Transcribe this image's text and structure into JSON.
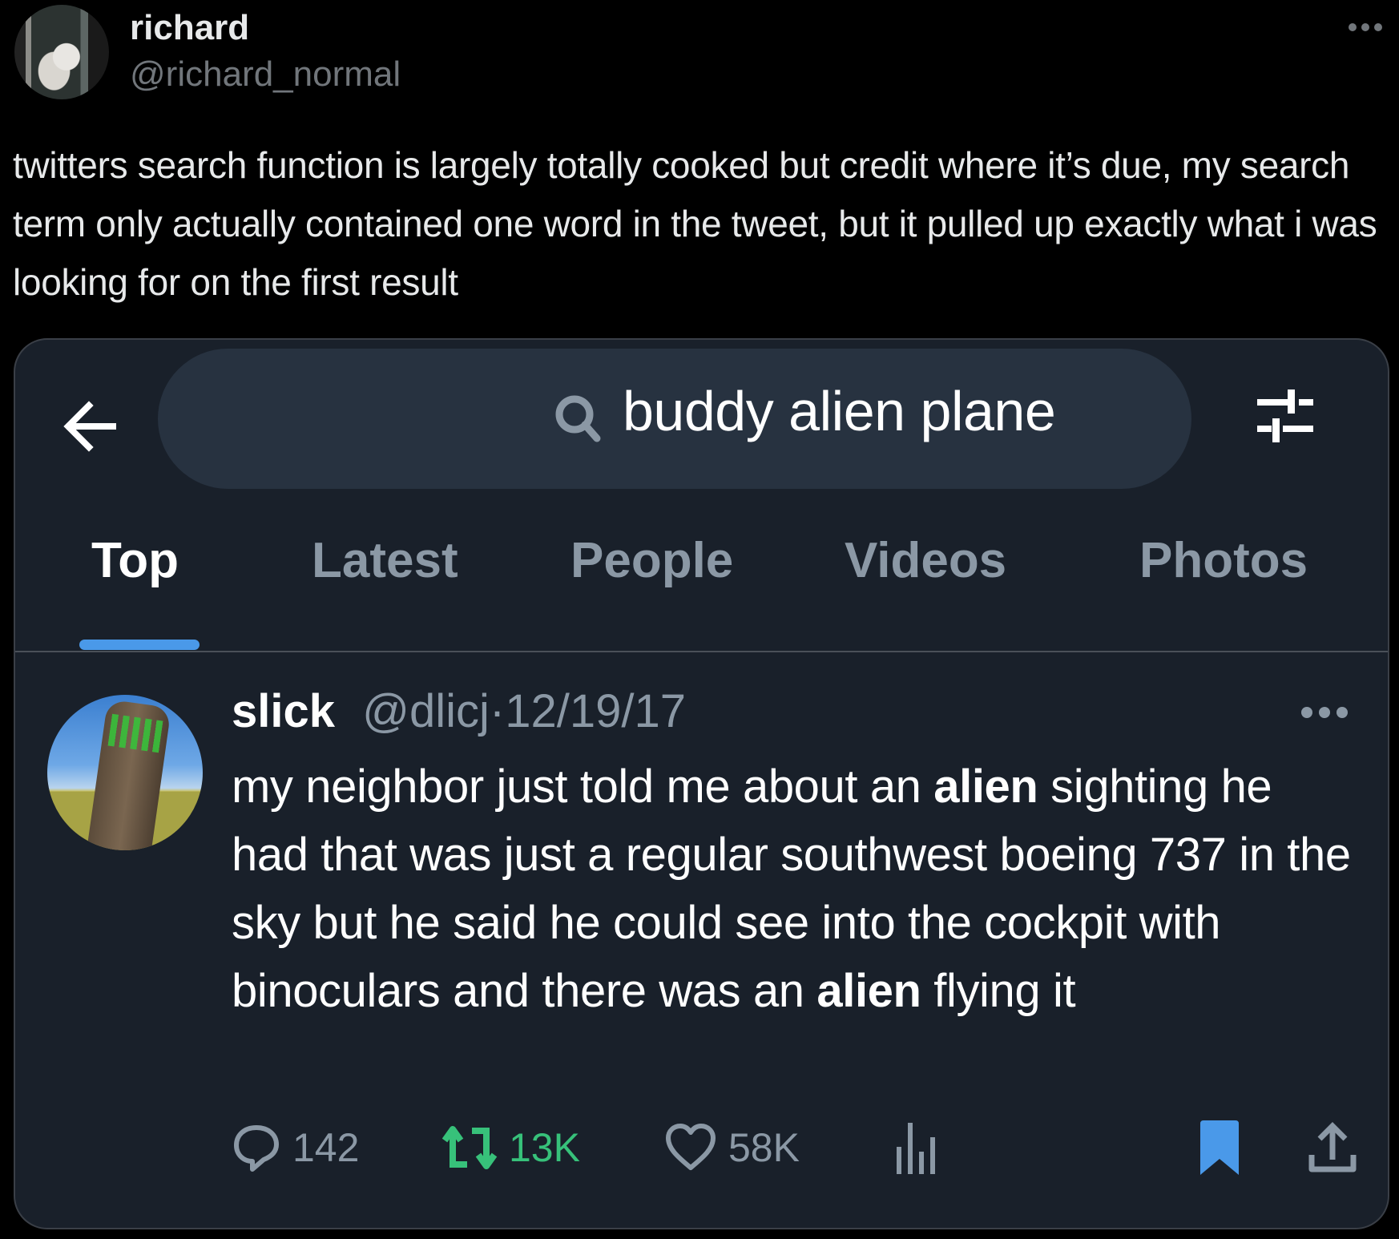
{
  "post": {
    "author": {
      "display_name": "richard",
      "handle": "@richard_normal",
      "avatar_icon": "profile-photo"
    },
    "more_icon": "more-horizontal-icon",
    "text": "twitters search function is largely totally cooked but credit where it’s due, my search term only actually contained one word in the tweet, but it pulled up exactly what i was looking for on the first result"
  },
  "embedded_screenshot": {
    "search": {
      "query": "buddy alien plane",
      "back_icon": "arrow-left-icon",
      "search_icon": "search-icon",
      "filter_icon": "sliders-icon"
    },
    "tabs": [
      {
        "label": "Top",
        "active": true
      },
      {
        "label": "Latest",
        "active": false
      },
      {
        "label": "People",
        "active": false
      },
      {
        "label": "Videos",
        "active": false
      },
      {
        "label": "Photos",
        "active": false
      }
    ],
    "accent_color": "#4a99e9",
    "result_tweet": {
      "display_name": "slick",
      "handle": "@dlicj",
      "separator": "·",
      "date": "12/19/17",
      "body_segments": [
        {
          "text": "my neighbor just told me about an ",
          "bold": false
        },
        {
          "text": "alien",
          "bold": true
        },
        {
          "text": " sighting he had that was just a regular southwest boeing 737 in the sky but he said he could see into the cockpit with binoculars and there was an ",
          "bold": false
        },
        {
          "text": "alien",
          "bold": true
        },
        {
          "text": " flying it",
          "bold": false
        }
      ],
      "metrics": {
        "replies": "142",
        "retweets": "13K",
        "likes": "58K"
      },
      "retweeted": true,
      "bookmarked": true,
      "retweet_color": "#37c17a",
      "bookmark_color": "#4a99e9"
    }
  }
}
